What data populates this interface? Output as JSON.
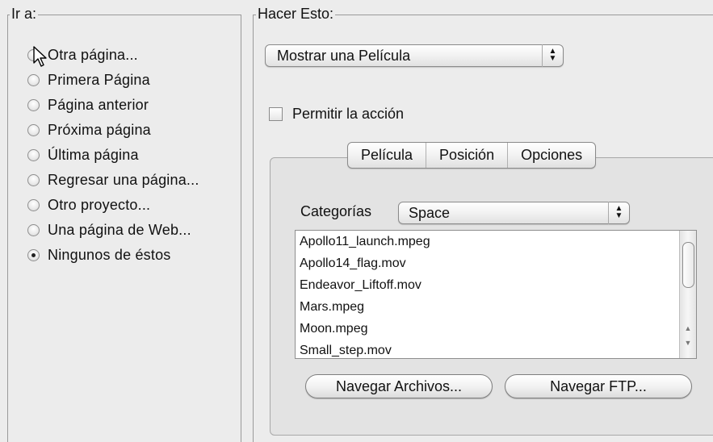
{
  "left_group": {
    "title": "Ir a:",
    "options": [
      {
        "label": "Otra página...",
        "checked": false
      },
      {
        "label": "Primera Página",
        "checked": false
      },
      {
        "label": "Página anterior",
        "checked": false
      },
      {
        "label": "Próxima página",
        "checked": false
      },
      {
        "label": "Última página",
        "checked": false
      },
      {
        "label": "Regresar una página...",
        "checked": false
      },
      {
        "label": "Otro proyecto...",
        "checked": false
      },
      {
        "label": "Una página de Web...",
        "checked": false
      },
      {
        "label": "Ningunos de éstos",
        "checked": true
      }
    ]
  },
  "right_group": {
    "title": "Hacer Esto:",
    "action_popup": {
      "value": "Mostrar una Película"
    },
    "allow_checkbox": {
      "label": "Permitir la acción",
      "checked": false
    },
    "tabs": [
      {
        "label": "Película",
        "selected": true
      },
      {
        "label": "Posición",
        "selected": false
      },
      {
        "label": "Opciones",
        "selected": false
      }
    ],
    "categories": {
      "label": "Categorías",
      "value": "Space"
    },
    "files": [
      "Apollo11_launch.mpeg",
      "Apollo14_flag.mov",
      "Endeavor_Liftoff.mov",
      "Mars.mpeg",
      "Moon.mpeg",
      "Small_step.mov"
    ],
    "buttons": {
      "browse_files": "Navegar Archivos...",
      "browse_ftp": "Navegar FTP..."
    }
  }
}
